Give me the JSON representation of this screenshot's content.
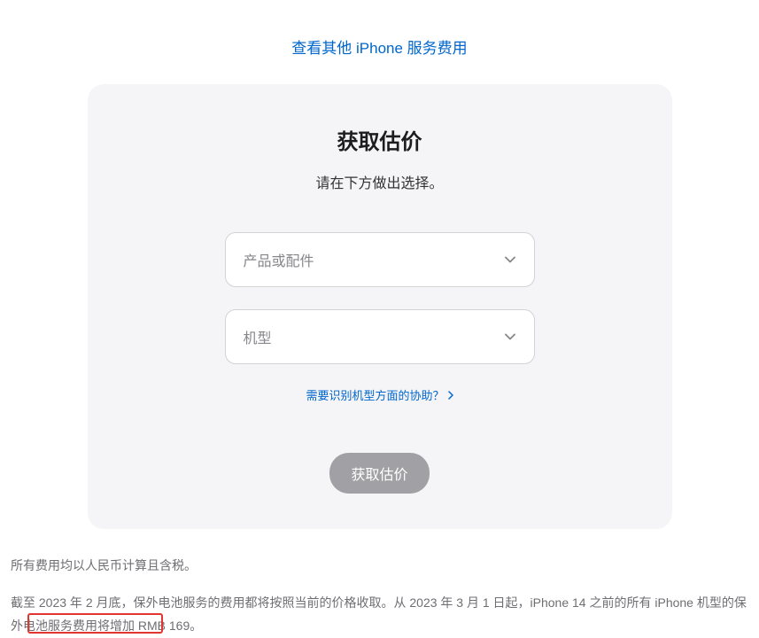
{
  "top_link": "查看其他 iPhone 服务费用",
  "card": {
    "title": "获取估价",
    "subtitle": "请在下方做出选择。",
    "select_product_placeholder": "产品或配件",
    "select_model_placeholder": "机型",
    "help_link": "需要识别机型方面的协助？",
    "submit_button": "获取估价"
  },
  "footer": {
    "line1": "所有费用均以人民币计算且含税。",
    "line2": "截至 2023 年 2 月底，保外电池服务的费用都将按照当前的价格收取。从 2023 年 3 月 1 日起，iPhone 14 之前的所有 iPhone 机型的保外电池服务费用将增加 RMB 169。"
  }
}
